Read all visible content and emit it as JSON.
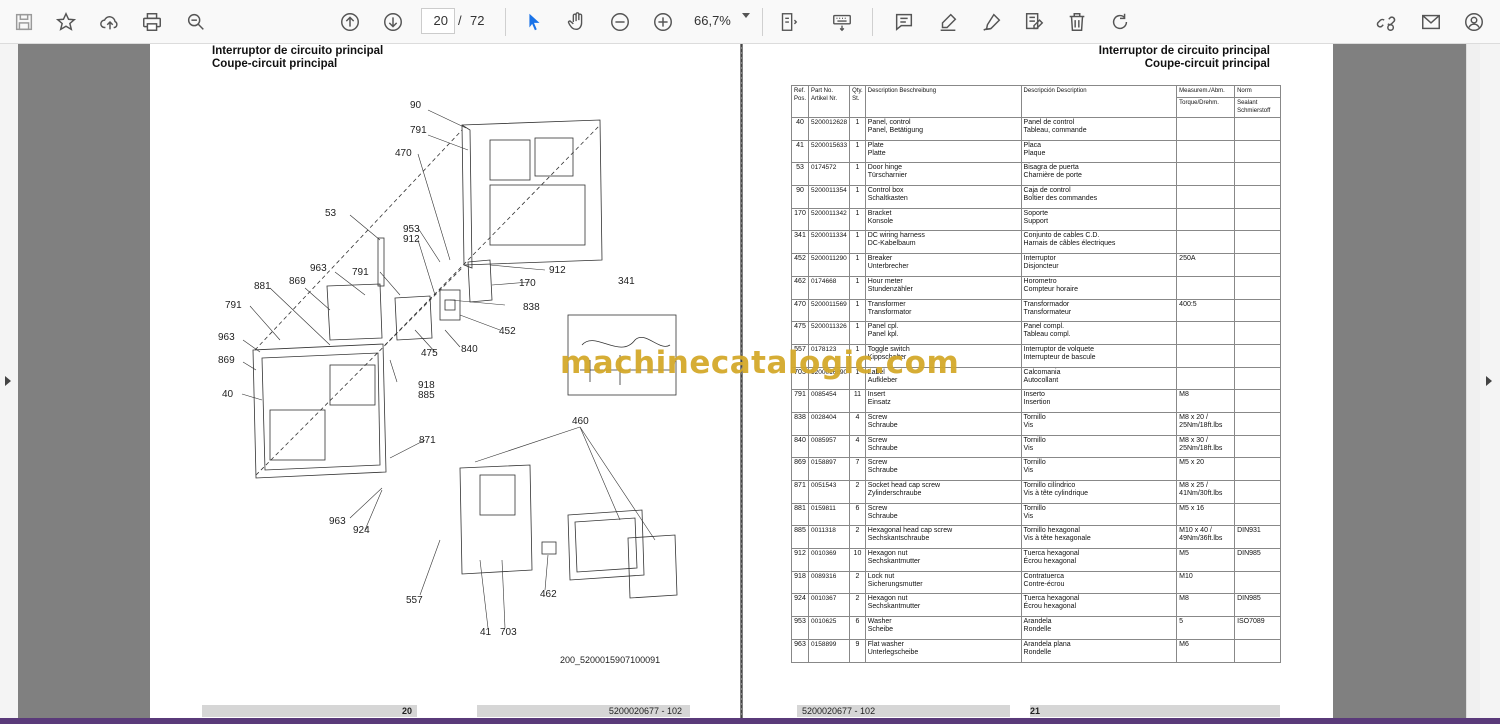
{
  "toolbar": {
    "page_current": "20",
    "page_sep": "/",
    "page_total": "72",
    "zoom": "66,7%"
  },
  "left_page": {
    "title_es": "Interruptor de circuito principal",
    "title_fr": "Coupe-circuit principal",
    "figure_ref": "200_5200015907100091",
    "page_number": "20",
    "doc_number": "5200020677 - 102",
    "callouts": [
      "90",
      "791",
      "470",
      "53",
      "953",
      "912",
      "963",
      "791",
      "881",
      "869",
      "912",
      "170",
      "838",
      "341",
      "791",
      "452",
      "963",
      "869",
      "475",
      "840",
      "918",
      "885",
      "40",
      "871",
      "460",
      "963",
      "924",
      "557",
      "462",
      "41",
      "703"
    ]
  },
  "right_page": {
    "title_es": "Interruptor de circuito principal",
    "title_fr": "Coupe-circuit principal",
    "page_number": "21",
    "doc_number": "5200020677 - 102"
  },
  "watermark": "machinecatalogic.com",
  "table": {
    "headers": {
      "ref": "Ref. Pos.",
      "part": "Part No. Artikel Nr.",
      "qty": "Qty. St.",
      "desc_en": "Description Beschreibung",
      "desc_es": "Descripción Description",
      "meas": "Measurem./Abm.",
      "torque": "Torque/Drehm.",
      "norm": "Norm",
      "sealant": "Sealant Schmierstoff"
    },
    "rows": [
      {
        "ref": "40",
        "part": "5200012628",
        "qty": "1",
        "d1": "Panel, control",
        "d2": "Panel, Betätigung",
        "e1": "Panel de control",
        "e2": "Tableau, commande",
        "m": "",
        "n": ""
      },
      {
        "ref": "41",
        "part": "5200015633",
        "qty": "1",
        "d1": "Plate",
        "d2": "Platte",
        "e1": "Placa",
        "e2": "Plaque",
        "m": "",
        "n": ""
      },
      {
        "ref": "53",
        "part": "0174572",
        "qty": "1",
        "d1": "Door hinge",
        "d2": "Türscharnier",
        "e1": "Bisagra de puerta",
        "e2": "Charnière de porte",
        "m": "",
        "n": ""
      },
      {
        "ref": "90",
        "part": "5200011354",
        "qty": "1",
        "d1": "Control box",
        "d2": "Schaltkasten",
        "e1": "Caja de control",
        "e2": "Boîtier des commandes",
        "m": "",
        "n": ""
      },
      {
        "ref": "170",
        "part": "5200011342",
        "qty": "1",
        "d1": "Bracket",
        "d2": "Konsole",
        "e1": "Soporte",
        "e2": "Support",
        "m": "",
        "n": ""
      },
      {
        "ref": "341",
        "part": "5200011334",
        "qty": "1",
        "d1": "DC wiring harness",
        "d2": "DC-Kabelbaum",
        "e1": "Conjunto de cables C.D.",
        "e2": "Harnais de câbles électriques",
        "m": "",
        "n": ""
      },
      {
        "ref": "452",
        "part": "5200011290",
        "qty": "1",
        "d1": "Breaker",
        "d2": "Unterbrecher",
        "e1": "Interruptor",
        "e2": "Disjoncteur",
        "m": "250A",
        "n": ""
      },
      {
        "ref": "462",
        "part": "0174668",
        "qty": "1",
        "d1": "Hour meter",
        "d2": "Stundenzähler",
        "e1": "Horometro",
        "e2": "Compteur horaire",
        "m": "",
        "n": ""
      },
      {
        "ref": "470",
        "part": "5200011569",
        "qty": "1",
        "d1": "Transformer",
        "d2": "Transformator",
        "e1": "Transformador",
        "e2": "Transformateur",
        "m": "400:5",
        "n": ""
      },
      {
        "ref": "475",
        "part": "5200011326",
        "qty": "1",
        "d1": "Panel cpl.",
        "d2": "Panel kpl.",
        "e1": "Panel compl.",
        "e2": "Tableau compl.",
        "m": "",
        "n": ""
      },
      {
        "ref": "557",
        "part": "0178123",
        "qty": "1",
        "d1": "Toggle switch",
        "d2": "Kippschalter",
        "e1": "Interruptor de volquete",
        "e2": "Interrupteur de bascule",
        "m": "",
        "n": ""
      },
      {
        "ref": "703",
        "part": "5200016890",
        "qty": "1",
        "d1": "Label",
        "d2": "Aufkleber",
        "e1": "Calcomania",
        "e2": "Autocollant",
        "m": "",
        "n": ""
      },
      {
        "ref": "791",
        "part": "0085454",
        "qty": "11",
        "d1": "Insert",
        "d2": "Einsatz",
        "e1": "Inserto",
        "e2": "Insertion",
        "m": "M8",
        "n": ""
      },
      {
        "ref": "838",
        "part": "0028404",
        "qty": "4",
        "d1": "Screw",
        "d2": "Schraube",
        "e1": "Tornillo",
        "e2": "Vis",
        "m": "M8 x 20 / 25Nm/18ft.lbs",
        "n": ""
      },
      {
        "ref": "840",
        "part": "0085957",
        "qty": "4",
        "d1": "Screw",
        "d2": "Schraube",
        "e1": "Tornillo",
        "e2": "Vis",
        "m": "M8 x 30 / 25Nm/18ft.lbs",
        "n": ""
      },
      {
        "ref": "869",
        "part": "0158897",
        "qty": "7",
        "d1": "Screw",
        "d2": "Schraube",
        "e1": "Tornillo",
        "e2": "Vis",
        "m": "M5 x 20",
        "n": ""
      },
      {
        "ref": "871",
        "part": "0051543",
        "qty": "2",
        "d1": "Socket head cap screw",
        "d2": "Zylinderschraube",
        "e1": "Tornillo cilíndrico",
        "e2": "Vis à tête cylindrique",
        "m": "M8 x 25 / 41Nm/30ft.lbs",
        "n": ""
      },
      {
        "ref": "881",
        "part": "0159811",
        "qty": "6",
        "d1": "Screw",
        "d2": "Schraube",
        "e1": "Tornillo",
        "e2": "Vis",
        "m": "M5 x 16",
        "n": ""
      },
      {
        "ref": "885",
        "part": "0011318",
        "qty": "2",
        "d1": "Hexagonal head cap screw",
        "d2": "Sechskantschraube",
        "e1": "Tornillo hexagonal",
        "e2": "Vis à tête hexagonale",
        "m": "M10 x 40 / 49Nm/36ft.lbs",
        "n": "DIN931"
      },
      {
        "ref": "912",
        "part": "0010369",
        "qty": "10",
        "d1": "Hexagon nut",
        "d2": "Sechskantmutter",
        "e1": "Tuerca hexagonal",
        "e2": "Écrou hexagonal",
        "m": "M5",
        "n": "DIN985"
      },
      {
        "ref": "918",
        "part": "0089316",
        "qty": "2",
        "d1": "Lock nut",
        "d2": "Sicherungsmutter",
        "e1": "Contratuerca",
        "e2": "Contre-écrou",
        "m": "M10",
        "n": ""
      },
      {
        "ref": "924",
        "part": "0010367",
        "qty": "2",
        "d1": "Hexagon nut",
        "d2": "Sechskantmutter",
        "e1": "Tuerca hexagonal",
        "e2": "Écrou hexagonal",
        "m": "M8",
        "n": "DIN985"
      },
      {
        "ref": "953",
        "part": "0010625",
        "qty": "6",
        "d1": "Washer",
        "d2": "Scheibe",
        "e1": "Arandela",
        "e2": "Rondelle",
        "m": "5",
        "n": "ISO7089"
      },
      {
        "ref": "963",
        "part": "0158899",
        "qty": "9",
        "d1": "Flat washer",
        "d2": "Unterlegscheibe",
        "e1": "Arandela plana",
        "e2": "Rondelle",
        "m": "M6",
        "n": ""
      }
    ]
  }
}
